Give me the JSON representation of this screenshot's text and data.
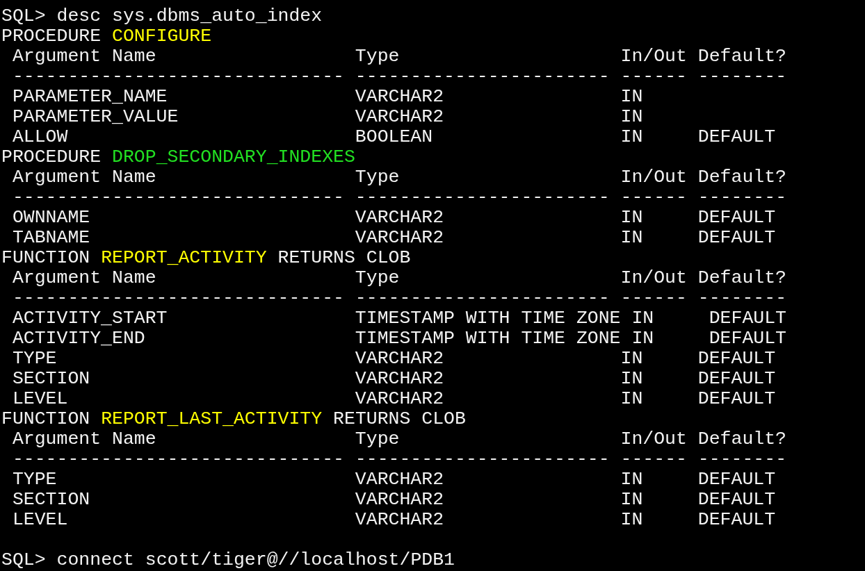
{
  "command": {
    "prompt": "SQL>",
    "text": "desc sys.dbms_auto_index"
  },
  "sections": [
    {
      "kind": "PROCEDURE",
      "name": "CONFIGURE",
      "color": "#ffff00",
      "header": [
        {
          "label": "Argument Name",
          "rule": "------------------------------"
        },
        {
          "label": "Type",
          "rule": "-----------------------"
        },
        {
          "label": "In/Out",
          "rule": "------"
        },
        {
          "label": "Default?",
          "rule": "--------"
        }
      ],
      "rows": [
        {
          "argument": "PARAMETER_NAME",
          "type": "VARCHAR2",
          "in_out": "IN"
        },
        {
          "argument": "PARAMETER_VALUE",
          "type": "VARCHAR2",
          "in_out": "IN"
        },
        {
          "argument": "ALLOW",
          "type": "BOOLEAN",
          "in_out": "IN",
          "default": "DEFAULT"
        }
      ]
    },
    {
      "kind": "PROCEDURE",
      "name": "DROP_SECONDARY_INDEXES",
      "color": "#22e022",
      "header": [
        {
          "label": "Argument Name",
          "rule": "------------------------------"
        },
        {
          "label": "Type",
          "rule": "-----------------------"
        },
        {
          "label": "In/Out",
          "rule": "------"
        },
        {
          "label": "Default?",
          "rule": "--------"
        }
      ],
      "rows": [
        {
          "argument": "OWNNAME",
          "type": "VARCHAR2",
          "in_out": "IN",
          "default": "DEFAULT"
        },
        {
          "argument": "TABNAME",
          "type": "VARCHAR2",
          "in_out": "IN",
          "default": "DEFAULT"
        }
      ]
    },
    {
      "kind": "FUNCTION",
      "name": "REPORT_ACTIVITY",
      "color": "#ffff00",
      "returns": "RETURNS CLOB",
      "header": [
        {
          "label": "Argument Name",
          "rule": "------------------------------"
        },
        {
          "label": "Type",
          "rule": "-----------------------"
        },
        {
          "label": "In/Out",
          "rule": "------"
        },
        {
          "label": "Default?",
          "rule": "--------"
        }
      ],
      "rows": [
        {
          "argument": "ACTIVITY_START",
          "type": "TIMESTAMP WITH TIME ZONE",
          "in_out": "IN",
          "default": "DEFAULT"
        },
        {
          "argument": "ACTIVITY_END",
          "type": "TIMESTAMP WITH TIME ZONE",
          "in_out": "IN",
          "default": "DEFAULT"
        },
        {
          "argument": "TYPE",
          "type": "VARCHAR2",
          "in_out": "IN",
          "default": "DEFAULT"
        },
        {
          "argument": "SECTION",
          "type": "VARCHAR2",
          "in_out": "IN",
          "default": "DEFAULT"
        },
        {
          "argument": "LEVEL",
          "type": "VARCHAR2",
          "in_out": "IN",
          "default": "DEFAULT"
        }
      ]
    },
    {
      "kind": "FUNCTION",
      "name": "REPORT_LAST_ACTIVITY",
      "color": "#ffff00",
      "returns": "RETURNS CLOB",
      "header": [
        {
          "label": "Argument Name",
          "rule": "------------------------------"
        },
        {
          "label": "Type",
          "rule": "-----------------------"
        },
        {
          "label": "In/Out",
          "rule": "------"
        },
        {
          "label": "Default?",
          "rule": "--------"
        }
      ],
      "rows": [
        {
          "argument": "TYPE",
          "type": "VARCHAR2",
          "in_out": "IN",
          "default": "DEFAULT"
        },
        {
          "argument": "SECTION",
          "type": "VARCHAR2",
          "in_out": "IN",
          "default": "DEFAULT"
        },
        {
          "argument": "LEVEL",
          "type": "VARCHAR2",
          "in_out": "IN",
          "default": "DEFAULT"
        }
      ]
    }
  ],
  "next_command": {
    "prompt": "SQL>",
    "text": "connect scott/tiger@//localhost/PDB1"
  }
}
